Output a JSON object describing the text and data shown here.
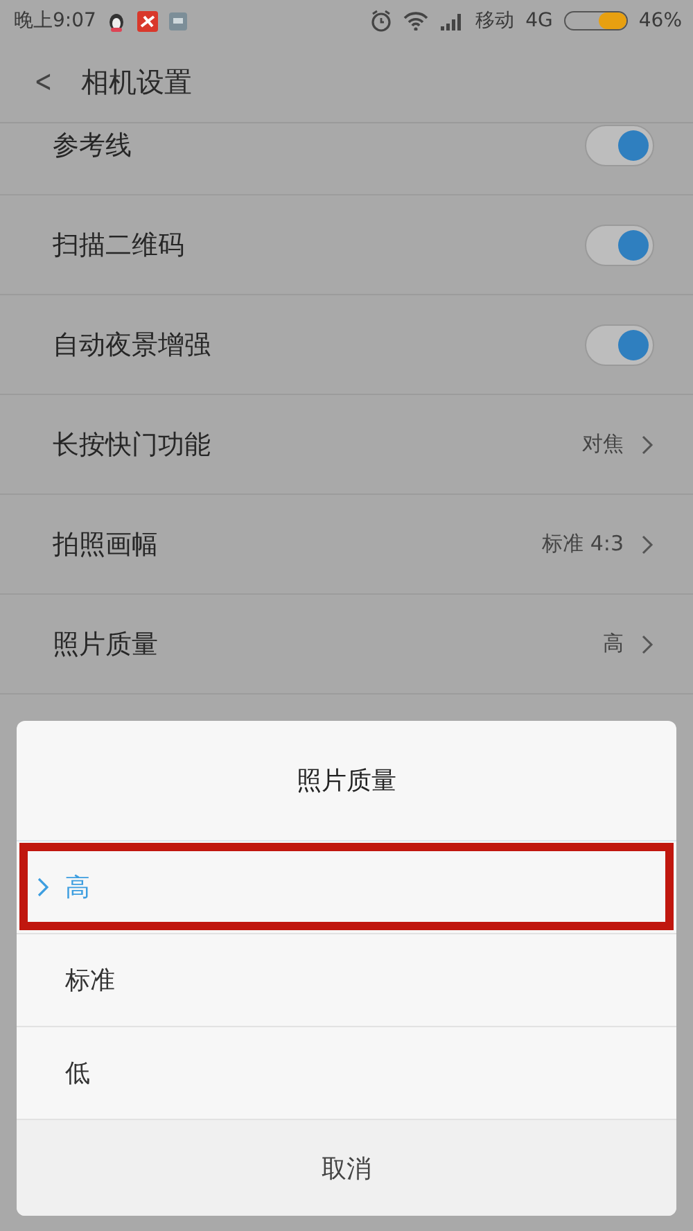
{
  "status_bar": {
    "time": "晚上9:07",
    "carrier": "移动",
    "network": "4G",
    "battery_text": "46%"
  },
  "header": {
    "back": "<",
    "title": "相机设置"
  },
  "settings": [
    {
      "kind": "toggle",
      "label": "参考线",
      "on": true
    },
    {
      "kind": "toggle",
      "label": "扫描二维码",
      "on": true
    },
    {
      "kind": "toggle",
      "label": "自动夜景增强",
      "on": true
    },
    {
      "kind": "value",
      "label": "长按快门功能",
      "value": "对焦"
    },
    {
      "kind": "value",
      "label": "拍照画幅",
      "value": "标准 4:3"
    },
    {
      "kind": "value",
      "label": "照片质量",
      "value": "高"
    }
  ],
  "dialog": {
    "title": "照片质量",
    "options": [
      {
        "label": "高",
        "selected": true,
        "highlighted": true
      },
      {
        "label": "标准",
        "selected": false,
        "highlighted": false
      },
      {
        "label": "低",
        "selected": false,
        "highlighted": false
      }
    ],
    "cancel": "取消"
  }
}
